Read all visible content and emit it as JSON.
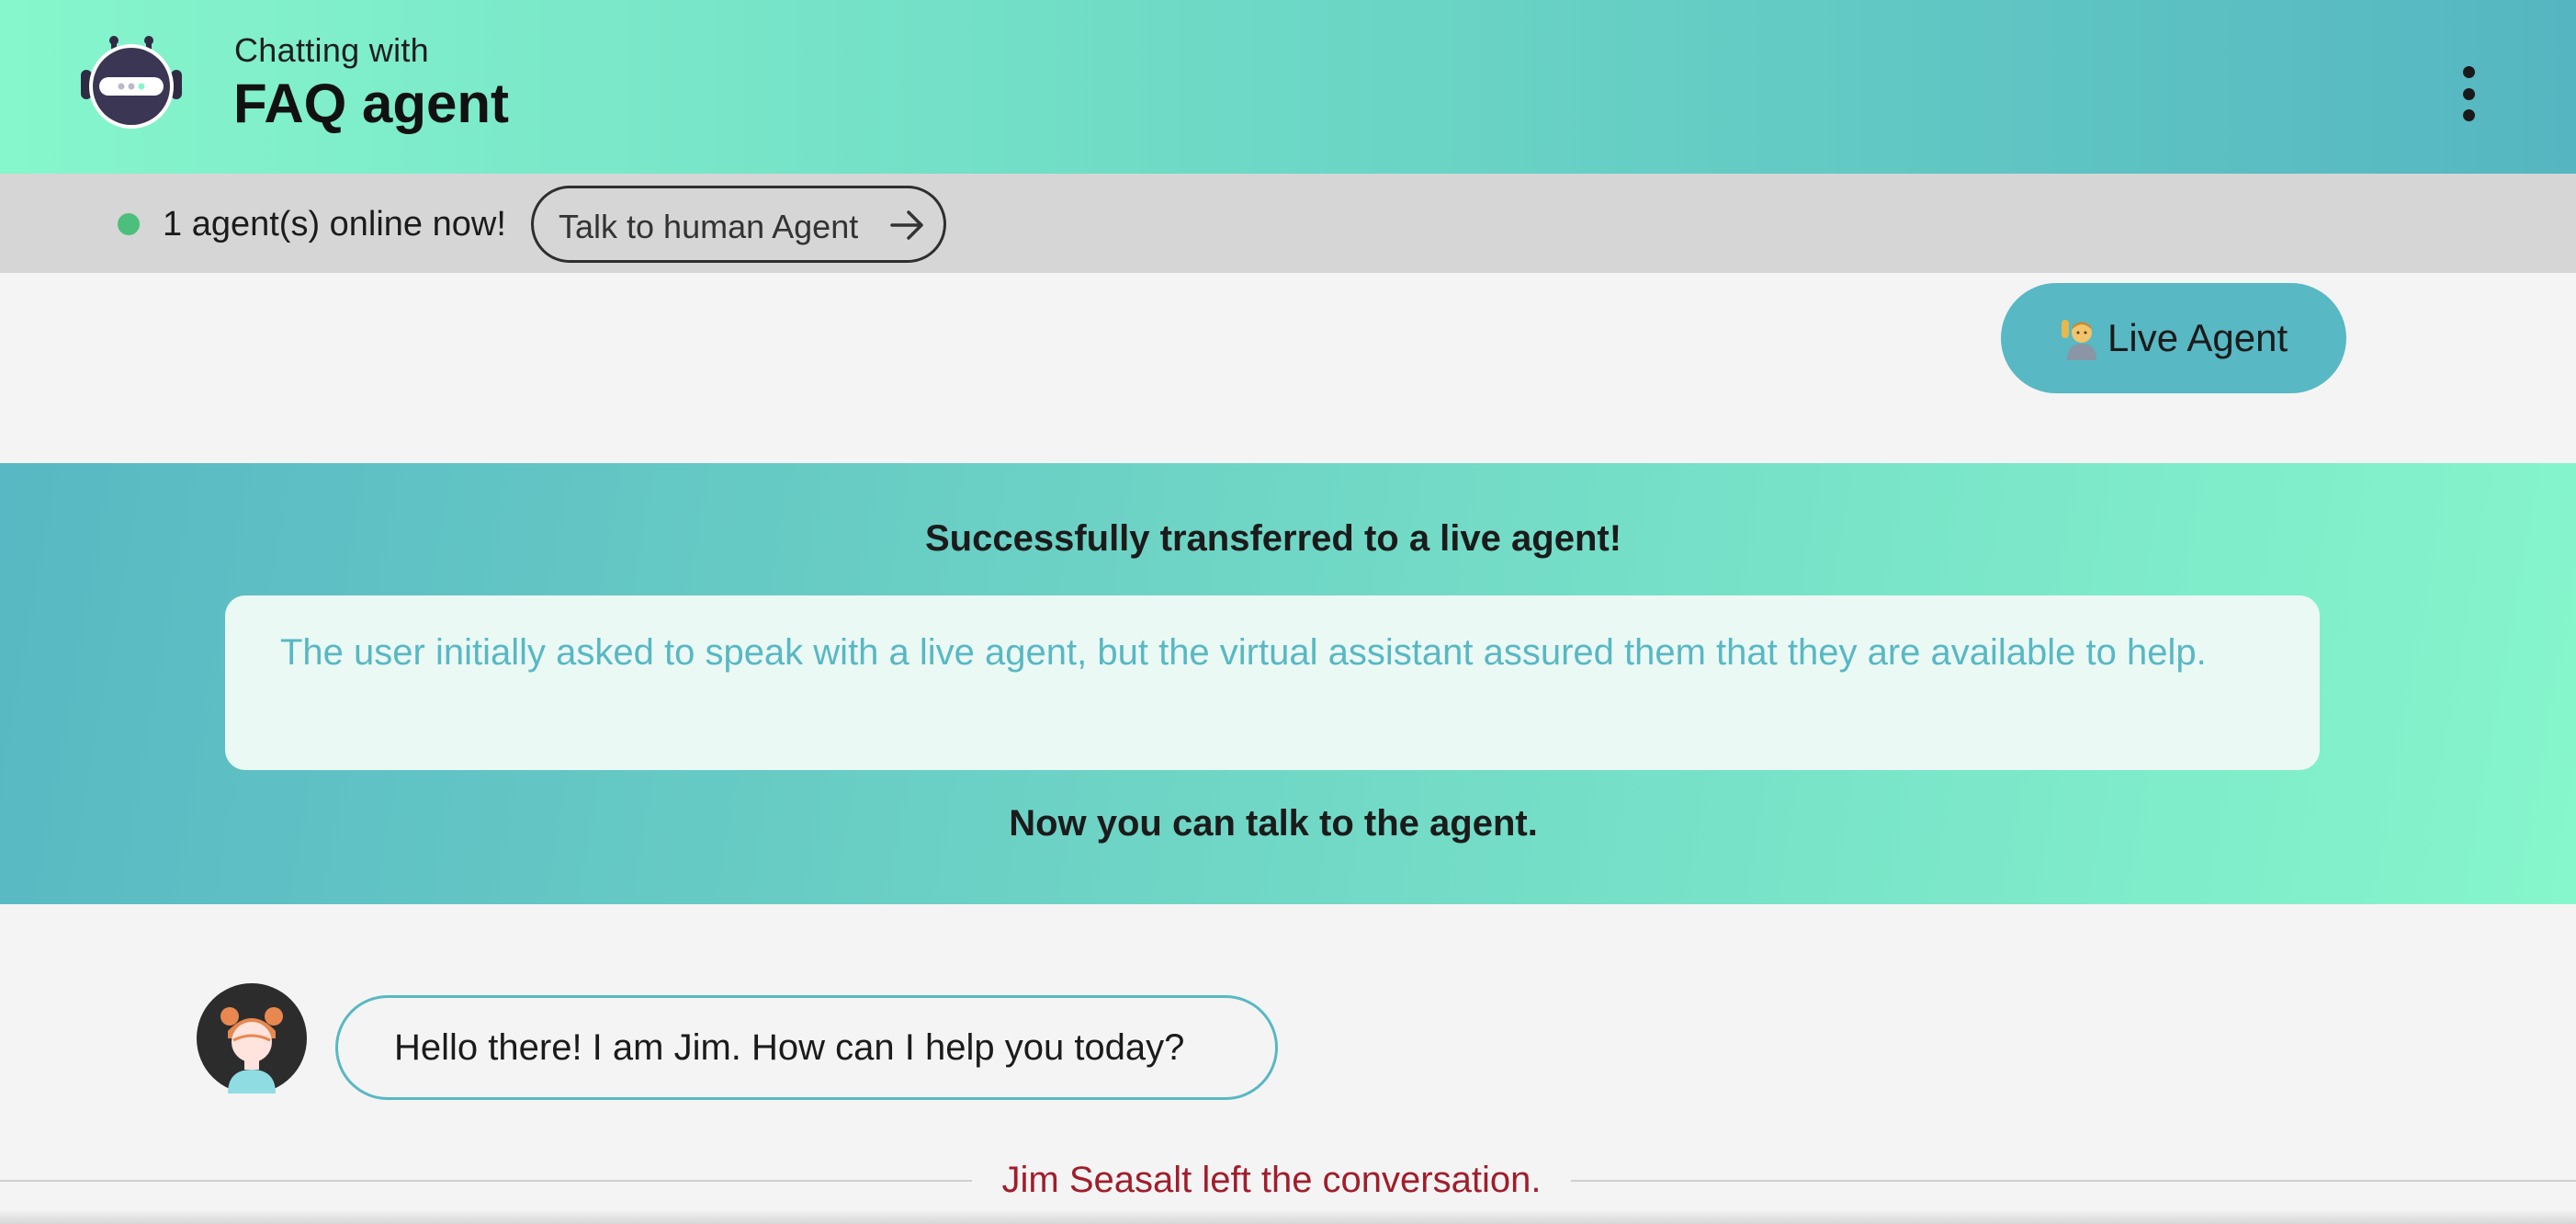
{
  "header": {
    "subtitle": "Chatting with",
    "title": "FAQ agent",
    "avatar_icon": "robot-icon",
    "menu_icon": "more-vertical-icon"
  },
  "status_bar": {
    "online_text": "1 agent(s) online now!",
    "online_color": "#4cbf7d",
    "talk_button_label": "Talk to human Agent",
    "talk_button_icon": "arrow-right-icon"
  },
  "live_agent_button": {
    "label": "Live Agent",
    "icon": "person-raising-hand-icon"
  },
  "transfer": {
    "title": "Successfully transferred to a live agent!",
    "summary": "The user initially asked to speak with a live agent, but the virtual assistant assured them that they are available to help.",
    "footer": "Now you can talk to the agent."
  },
  "messages": [
    {
      "sender_avatar": "agent-avatar",
      "text": "Hello there! I am Jim. How can I help you today?"
    }
  ],
  "system_notice": "Jim Seasalt left the conversation.",
  "colors": {
    "accent": "#58b8c3",
    "mint": "#86f6cc",
    "notice": "#a11d2b"
  }
}
